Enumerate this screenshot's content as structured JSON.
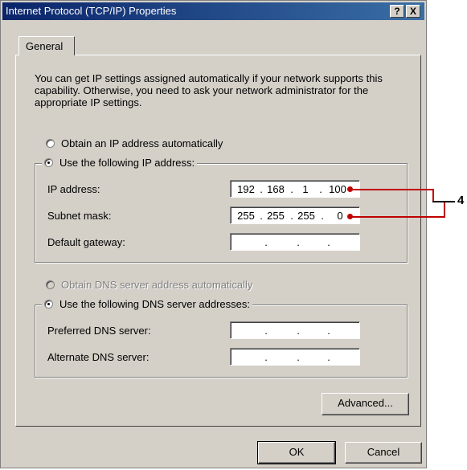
{
  "window": {
    "title": "Internet Protocol (TCP/IP) Properties",
    "help_label": "?",
    "close_label": "X"
  },
  "tabs": [
    {
      "label": "General"
    }
  ],
  "description": "You can get IP settings assigned automatically if your network supports this capability. Otherwise, you need to ask your network administrator for the appropriate IP settings.",
  "ip_mode": {
    "auto_label": "Obtain an IP address automatically",
    "manual_label": "Use the following IP address:",
    "selected": "manual"
  },
  "ip_fields": {
    "ip_address_label": "IP address:",
    "ip_address": [
      "192",
      "168",
      "1",
      "100"
    ],
    "subnet_label": "Subnet mask:",
    "subnet": [
      "255",
      "255",
      "255",
      "0"
    ],
    "gateway_label": "Default gateway:",
    "gateway": [
      "",
      "",
      "",
      ""
    ]
  },
  "dns_mode": {
    "auto_label": "Obtain DNS server address automatically",
    "auto_enabled": false,
    "manual_label": "Use the following DNS server addresses:",
    "selected": "manual"
  },
  "dns_fields": {
    "preferred_label": "Preferred DNS server:",
    "preferred": [
      "",
      "",
      "",
      ""
    ],
    "alternate_label": "Alternate DNS server:",
    "alternate": [
      "",
      "",
      "",
      ""
    ]
  },
  "buttons": {
    "advanced": "Advanced...",
    "ok": "OK",
    "cancel": "Cancel"
  },
  "callout": {
    "number": "4",
    "color": "#c00000"
  }
}
